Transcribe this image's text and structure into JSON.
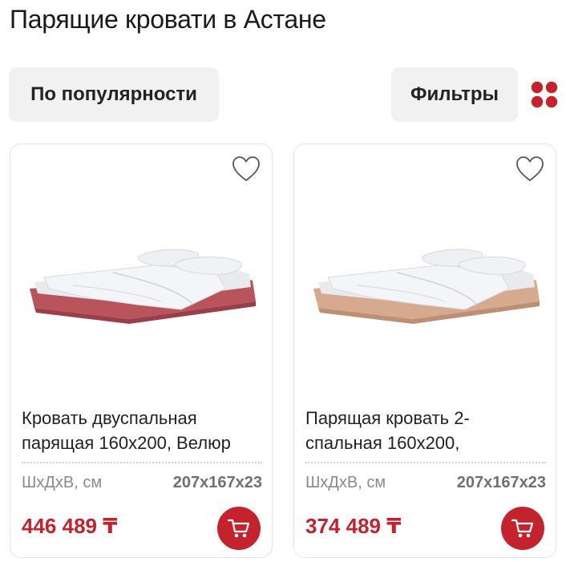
{
  "page": {
    "title": "Парящие кровати в Астане"
  },
  "toolbar": {
    "sort_label": "По популярности",
    "filter_label": "Фильтры",
    "view_toggle_icon": "grid-dots-icon"
  },
  "colors": {
    "accent": "#c4232d",
    "pill_bg": "#f1f1f1"
  },
  "products": [
    {
      "name": "Кровать двуспальная парящая 160х200, Велюр",
      "dims_label": "ШхДхВ, см",
      "dims_value": "207х167х23",
      "price": "446 489 ₸",
      "frame_color": "#b9535c",
      "fav_icon": "heart-outline-icon",
      "cart_icon": "cart-icon"
    },
    {
      "name": "Парящая кровать 2-спальная 160х200,",
      "dims_label": "ШхДхВ, см",
      "dims_value": "207х167х23",
      "price": "374 489 ₸",
      "frame_color": "#d7a98e",
      "fav_icon": "heart-outline-icon",
      "cart_icon": "cart-icon"
    }
  ]
}
